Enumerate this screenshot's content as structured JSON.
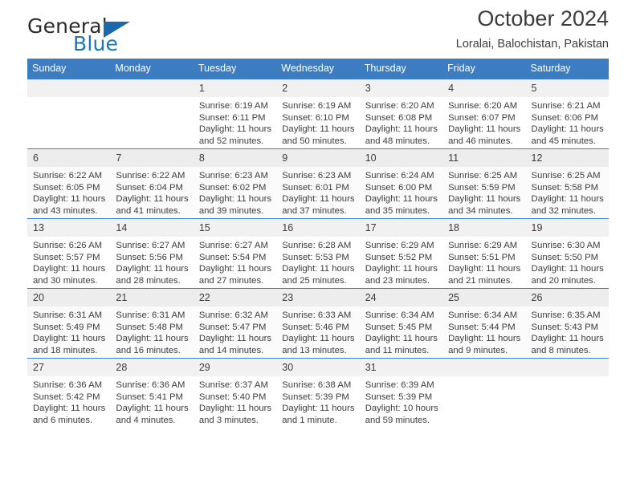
{
  "brand": {
    "name_top": "General",
    "name_bottom": "Blue",
    "accent_color": "#1b75bc",
    "triangle_icon": "triangle-icon"
  },
  "header": {
    "title": "October 2024",
    "subtitle": "Loralai, Balochistan, Pakistan"
  },
  "calendar": {
    "header_bg": "#3b7dc0",
    "weekday_headers": [
      "Sunday",
      "Monday",
      "Tuesday",
      "Wednesday",
      "Thursday",
      "Friday",
      "Saturday"
    ],
    "weeks": [
      [
        {
          "day": "",
          "lines": []
        },
        {
          "day": "",
          "lines": []
        },
        {
          "day": "1",
          "lines": [
            "Sunrise: 6:19 AM",
            "Sunset: 6:11 PM",
            "Daylight: 11 hours",
            "and 52 minutes."
          ]
        },
        {
          "day": "2",
          "lines": [
            "Sunrise: 6:19 AM",
            "Sunset: 6:10 PM",
            "Daylight: 11 hours",
            "and 50 minutes."
          ]
        },
        {
          "day": "3",
          "lines": [
            "Sunrise: 6:20 AM",
            "Sunset: 6:08 PM",
            "Daylight: 11 hours",
            "and 48 minutes."
          ]
        },
        {
          "day": "4",
          "lines": [
            "Sunrise: 6:20 AM",
            "Sunset: 6:07 PM",
            "Daylight: 11 hours",
            "and 46 minutes."
          ]
        },
        {
          "day": "5",
          "lines": [
            "Sunrise: 6:21 AM",
            "Sunset: 6:06 PM",
            "Daylight: 11 hours",
            "and 45 minutes."
          ]
        }
      ],
      [
        {
          "day": "6",
          "lines": [
            "Sunrise: 6:22 AM",
            "Sunset: 6:05 PM",
            "Daylight: 11 hours",
            "and 43 minutes."
          ]
        },
        {
          "day": "7",
          "lines": [
            "Sunrise: 6:22 AM",
            "Sunset: 6:04 PM",
            "Daylight: 11 hours",
            "and 41 minutes."
          ]
        },
        {
          "day": "8",
          "lines": [
            "Sunrise: 6:23 AM",
            "Sunset: 6:02 PM",
            "Daylight: 11 hours",
            "and 39 minutes."
          ]
        },
        {
          "day": "9",
          "lines": [
            "Sunrise: 6:23 AM",
            "Sunset: 6:01 PM",
            "Daylight: 11 hours",
            "and 37 minutes."
          ]
        },
        {
          "day": "10",
          "lines": [
            "Sunrise: 6:24 AM",
            "Sunset: 6:00 PM",
            "Daylight: 11 hours",
            "and 35 minutes."
          ]
        },
        {
          "day": "11",
          "lines": [
            "Sunrise: 6:25 AM",
            "Sunset: 5:59 PM",
            "Daylight: 11 hours",
            "and 34 minutes."
          ]
        },
        {
          "day": "12",
          "lines": [
            "Sunrise: 6:25 AM",
            "Sunset: 5:58 PM",
            "Daylight: 11 hours",
            "and 32 minutes."
          ]
        }
      ],
      [
        {
          "day": "13",
          "lines": [
            "Sunrise: 6:26 AM",
            "Sunset: 5:57 PM",
            "Daylight: 11 hours",
            "and 30 minutes."
          ]
        },
        {
          "day": "14",
          "lines": [
            "Sunrise: 6:27 AM",
            "Sunset: 5:56 PM",
            "Daylight: 11 hours",
            "and 28 minutes."
          ]
        },
        {
          "day": "15",
          "lines": [
            "Sunrise: 6:27 AM",
            "Sunset: 5:54 PM",
            "Daylight: 11 hours",
            "and 27 minutes."
          ]
        },
        {
          "day": "16",
          "lines": [
            "Sunrise: 6:28 AM",
            "Sunset: 5:53 PM",
            "Daylight: 11 hours",
            "and 25 minutes."
          ]
        },
        {
          "day": "17",
          "lines": [
            "Sunrise: 6:29 AM",
            "Sunset: 5:52 PM",
            "Daylight: 11 hours",
            "and 23 minutes."
          ]
        },
        {
          "day": "18",
          "lines": [
            "Sunrise: 6:29 AM",
            "Sunset: 5:51 PM",
            "Daylight: 11 hours",
            "and 21 minutes."
          ]
        },
        {
          "day": "19",
          "lines": [
            "Sunrise: 6:30 AM",
            "Sunset: 5:50 PM",
            "Daylight: 11 hours",
            "and 20 minutes."
          ]
        }
      ],
      [
        {
          "day": "20",
          "lines": [
            "Sunrise: 6:31 AM",
            "Sunset: 5:49 PM",
            "Daylight: 11 hours",
            "and 18 minutes."
          ]
        },
        {
          "day": "21",
          "lines": [
            "Sunrise: 6:31 AM",
            "Sunset: 5:48 PM",
            "Daylight: 11 hours",
            "and 16 minutes."
          ]
        },
        {
          "day": "22",
          "lines": [
            "Sunrise: 6:32 AM",
            "Sunset: 5:47 PM",
            "Daylight: 11 hours",
            "and 14 minutes."
          ]
        },
        {
          "day": "23",
          "lines": [
            "Sunrise: 6:33 AM",
            "Sunset: 5:46 PM",
            "Daylight: 11 hours",
            "and 13 minutes."
          ]
        },
        {
          "day": "24",
          "lines": [
            "Sunrise: 6:34 AM",
            "Sunset: 5:45 PM",
            "Daylight: 11 hours",
            "and 11 minutes."
          ]
        },
        {
          "day": "25",
          "lines": [
            "Sunrise: 6:34 AM",
            "Sunset: 5:44 PM",
            "Daylight: 11 hours",
            "and 9 minutes."
          ]
        },
        {
          "day": "26",
          "lines": [
            "Sunrise: 6:35 AM",
            "Sunset: 5:43 PM",
            "Daylight: 11 hours",
            "and 8 minutes."
          ]
        }
      ],
      [
        {
          "day": "27",
          "lines": [
            "Sunrise: 6:36 AM",
            "Sunset: 5:42 PM",
            "Daylight: 11 hours",
            "and 6 minutes."
          ]
        },
        {
          "day": "28",
          "lines": [
            "Sunrise: 6:36 AM",
            "Sunset: 5:41 PM",
            "Daylight: 11 hours",
            "and 4 minutes."
          ]
        },
        {
          "day": "29",
          "lines": [
            "Sunrise: 6:37 AM",
            "Sunset: 5:40 PM",
            "Daylight: 11 hours",
            "and 3 minutes."
          ]
        },
        {
          "day": "30",
          "lines": [
            "Sunrise: 6:38 AM",
            "Sunset: 5:39 PM",
            "Daylight: 11 hours",
            "and 1 minute."
          ]
        },
        {
          "day": "31",
          "lines": [
            "Sunrise: 6:39 AM",
            "Sunset: 5:39 PM",
            "Daylight: 10 hours",
            "and 59 minutes."
          ]
        },
        {
          "day": "",
          "lines": []
        },
        {
          "day": "",
          "lines": []
        }
      ]
    ]
  }
}
